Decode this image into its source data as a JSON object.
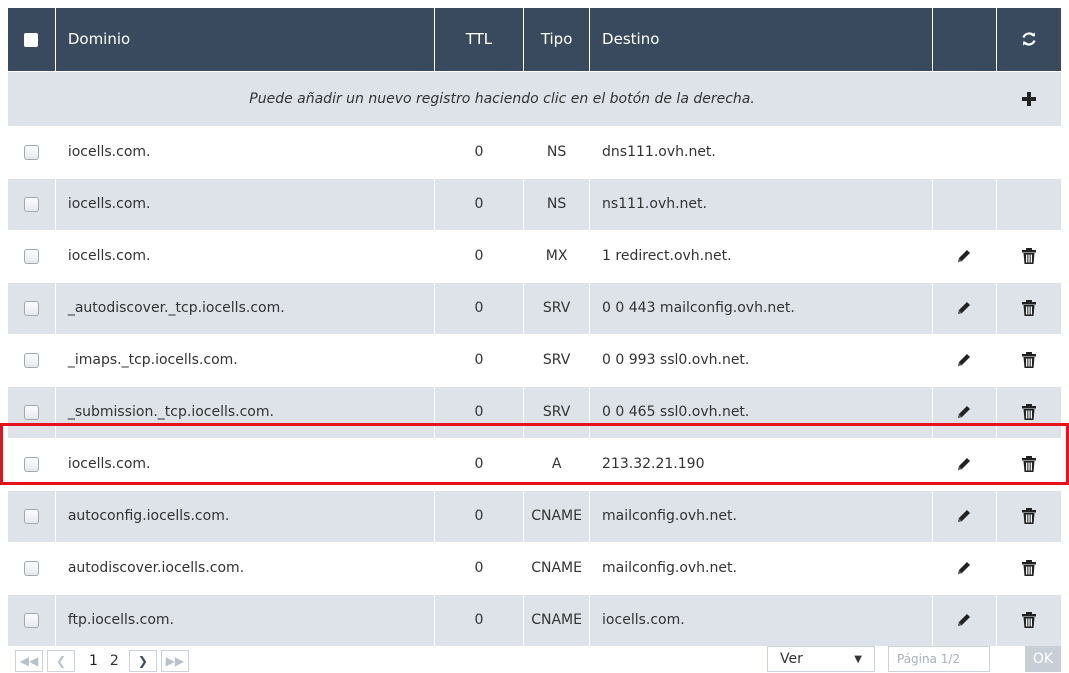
{
  "header": {
    "domain": "Dominio",
    "ttl": "TTL",
    "type": "Tipo",
    "target": "Destino"
  },
  "info_text": "Puede añadir un nuevo registro haciendo clic en el botón de la derecha.",
  "records": [
    {
      "domain": "iocells.com.",
      "ttl": "0",
      "type": "NS",
      "target": "dns111.ovh.net.",
      "editable": false
    },
    {
      "domain": "iocells.com.",
      "ttl": "0",
      "type": "NS",
      "target": "ns111.ovh.net.",
      "editable": false
    },
    {
      "domain": "iocells.com.",
      "ttl": "0",
      "type": "MX",
      "target": "1 redirect.ovh.net.",
      "editable": true
    },
    {
      "domain": "_autodiscover._tcp.iocells.com.",
      "ttl": "0",
      "type": "SRV",
      "target": "0 0 443 mailconfig.ovh.net.",
      "editable": true
    },
    {
      "domain": "_imaps._tcp.iocells.com.",
      "ttl": "0",
      "type": "SRV",
      "target": "0 0 993 ssl0.ovh.net.",
      "editable": true
    },
    {
      "domain": "_submission._tcp.iocells.com.",
      "ttl": "0",
      "type": "SRV",
      "target": "0 0 465 ssl0.ovh.net.",
      "editable": true
    },
    {
      "domain": "iocells.com.",
      "ttl": "0",
      "type": "A",
      "target": "213.32.21.190",
      "editable": true
    },
    {
      "domain": "autoconfig.iocells.com.",
      "ttl": "0",
      "type": "CNAME",
      "target": "mailconfig.ovh.net.",
      "editable": true
    },
    {
      "domain": "autodiscover.iocells.com.",
      "ttl": "0",
      "type": "CNAME",
      "target": "mailconfig.ovh.net.",
      "editable": true
    },
    {
      "domain": "ftp.iocells.com.",
      "ttl": "0",
      "type": "CNAME",
      "target": "iocells.com.",
      "editable": true
    }
  ],
  "highlighted_record": 7,
  "pagination": {
    "pages": [
      "1",
      "2"
    ],
    "current": "1",
    "view_label": "Ver",
    "page_placeholder": "Página 1/2",
    "ok_label": "OK"
  },
  "colors": {
    "header_bg": "#3a4a5e",
    "row_alt_bg": "#dde3e8",
    "highlight": "#e8101b"
  }
}
